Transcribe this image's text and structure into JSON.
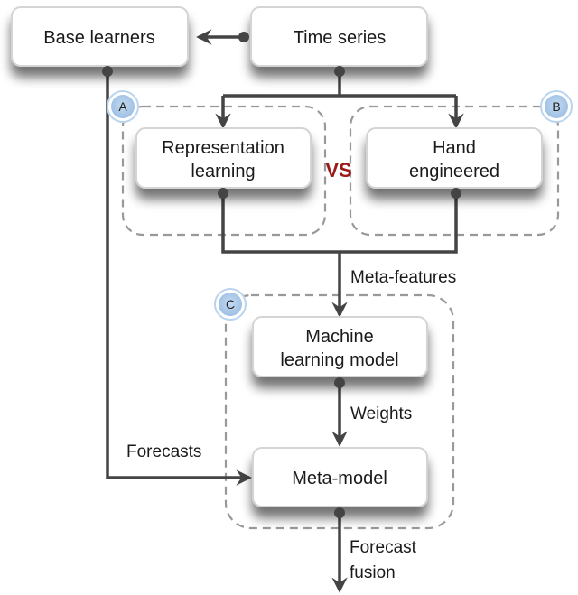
{
  "diagram": {
    "nodes": {
      "base_learners": "Base learners",
      "time_series": "Time series",
      "representation_learning": [
        "Representation",
        "learning"
      ],
      "hand_engineered": [
        "Hand",
        "engineered"
      ],
      "machine_learning_model": [
        "Machine",
        "learning model"
      ],
      "meta_model": "Meta-model"
    },
    "groups": {
      "a": "A",
      "b": "B",
      "c": "C"
    },
    "vs_label": "VS",
    "edge_labels": {
      "meta_features": "Meta-features",
      "weights": "Weights",
      "forecasts": "Forecasts",
      "forecast_fusion": [
        "Forecast",
        "fusion"
      ]
    },
    "colors": {
      "edge": "#444444",
      "group_border": "#999999",
      "badge_fill": "#a8c8e8",
      "badge_ring": "#b9d4ee",
      "vs": "#9b1b1b"
    }
  }
}
